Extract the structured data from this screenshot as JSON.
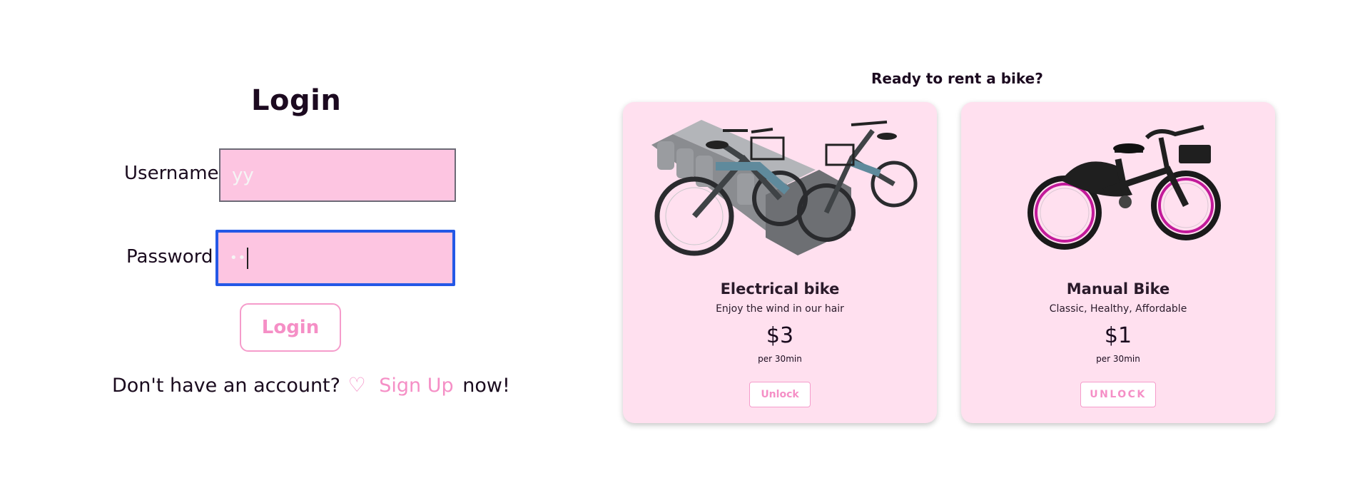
{
  "login": {
    "title": "Login",
    "username_label": "Username",
    "username_value": "yy",
    "password_label": "Password",
    "password_value": "••",
    "button_label": "Login",
    "signup_prefix": "Don't have an account?",
    "heart_glyph": "♡",
    "signup_link": "Sign Up",
    "signup_suffix": "now!"
  },
  "rent": {
    "title": "Ready to rent a bike?",
    "cards": [
      {
        "title": "Electrical bike",
        "description": "Enjoy the wind in our hair",
        "price": "$3",
        "per": "per 30min",
        "button": "Unlock",
        "image": "electric-bike-docking-station-image"
      },
      {
        "title": "Manual Bike",
        "description": "Classic, Healthy, Affordable",
        "price": "$1",
        "per": "per 30min",
        "button": "UNLOCK",
        "image": "manual-bike-image"
      }
    ]
  },
  "colors": {
    "accent_pink": "#f58fc6",
    "field_pink": "#fdc5e1",
    "card_pink": "#ffe0ef",
    "focus_blue": "#2458e6",
    "text_dark": "#1a0b1e"
  }
}
